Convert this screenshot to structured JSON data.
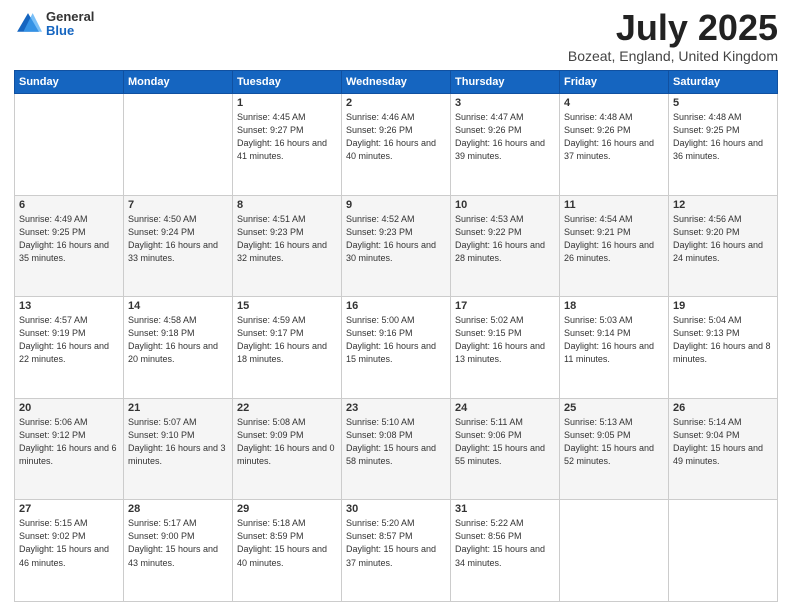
{
  "header": {
    "logo": {
      "general": "General",
      "blue": "Blue"
    },
    "title": "July 2025",
    "location": "Bozeat, England, United Kingdom"
  },
  "weekdays": [
    "Sunday",
    "Monday",
    "Tuesday",
    "Wednesday",
    "Thursday",
    "Friday",
    "Saturday"
  ],
  "weeks": [
    [
      {
        "day": null
      },
      {
        "day": null
      },
      {
        "day": "1",
        "sunrise": "Sunrise: 4:45 AM",
        "sunset": "Sunset: 9:27 PM",
        "daylight": "Daylight: 16 hours and 41 minutes."
      },
      {
        "day": "2",
        "sunrise": "Sunrise: 4:46 AM",
        "sunset": "Sunset: 9:26 PM",
        "daylight": "Daylight: 16 hours and 40 minutes."
      },
      {
        "day": "3",
        "sunrise": "Sunrise: 4:47 AM",
        "sunset": "Sunset: 9:26 PM",
        "daylight": "Daylight: 16 hours and 39 minutes."
      },
      {
        "day": "4",
        "sunrise": "Sunrise: 4:48 AM",
        "sunset": "Sunset: 9:26 PM",
        "daylight": "Daylight: 16 hours and 37 minutes."
      },
      {
        "day": "5",
        "sunrise": "Sunrise: 4:48 AM",
        "sunset": "Sunset: 9:25 PM",
        "daylight": "Daylight: 16 hours and 36 minutes."
      }
    ],
    [
      {
        "day": "6",
        "sunrise": "Sunrise: 4:49 AM",
        "sunset": "Sunset: 9:25 PM",
        "daylight": "Daylight: 16 hours and 35 minutes."
      },
      {
        "day": "7",
        "sunrise": "Sunrise: 4:50 AM",
        "sunset": "Sunset: 9:24 PM",
        "daylight": "Daylight: 16 hours and 33 minutes."
      },
      {
        "day": "8",
        "sunrise": "Sunrise: 4:51 AM",
        "sunset": "Sunset: 9:23 PM",
        "daylight": "Daylight: 16 hours and 32 minutes."
      },
      {
        "day": "9",
        "sunrise": "Sunrise: 4:52 AM",
        "sunset": "Sunset: 9:23 PM",
        "daylight": "Daylight: 16 hours and 30 minutes."
      },
      {
        "day": "10",
        "sunrise": "Sunrise: 4:53 AM",
        "sunset": "Sunset: 9:22 PM",
        "daylight": "Daylight: 16 hours and 28 minutes."
      },
      {
        "day": "11",
        "sunrise": "Sunrise: 4:54 AM",
        "sunset": "Sunset: 9:21 PM",
        "daylight": "Daylight: 16 hours and 26 minutes."
      },
      {
        "day": "12",
        "sunrise": "Sunrise: 4:56 AM",
        "sunset": "Sunset: 9:20 PM",
        "daylight": "Daylight: 16 hours and 24 minutes."
      }
    ],
    [
      {
        "day": "13",
        "sunrise": "Sunrise: 4:57 AM",
        "sunset": "Sunset: 9:19 PM",
        "daylight": "Daylight: 16 hours and 22 minutes."
      },
      {
        "day": "14",
        "sunrise": "Sunrise: 4:58 AM",
        "sunset": "Sunset: 9:18 PM",
        "daylight": "Daylight: 16 hours and 20 minutes."
      },
      {
        "day": "15",
        "sunrise": "Sunrise: 4:59 AM",
        "sunset": "Sunset: 9:17 PM",
        "daylight": "Daylight: 16 hours and 18 minutes."
      },
      {
        "day": "16",
        "sunrise": "Sunrise: 5:00 AM",
        "sunset": "Sunset: 9:16 PM",
        "daylight": "Daylight: 16 hours and 15 minutes."
      },
      {
        "day": "17",
        "sunrise": "Sunrise: 5:02 AM",
        "sunset": "Sunset: 9:15 PM",
        "daylight": "Daylight: 16 hours and 13 minutes."
      },
      {
        "day": "18",
        "sunrise": "Sunrise: 5:03 AM",
        "sunset": "Sunset: 9:14 PM",
        "daylight": "Daylight: 16 hours and 11 minutes."
      },
      {
        "day": "19",
        "sunrise": "Sunrise: 5:04 AM",
        "sunset": "Sunset: 9:13 PM",
        "daylight": "Daylight: 16 hours and 8 minutes."
      }
    ],
    [
      {
        "day": "20",
        "sunrise": "Sunrise: 5:06 AM",
        "sunset": "Sunset: 9:12 PM",
        "daylight": "Daylight: 16 hours and 6 minutes."
      },
      {
        "day": "21",
        "sunrise": "Sunrise: 5:07 AM",
        "sunset": "Sunset: 9:10 PM",
        "daylight": "Daylight: 16 hours and 3 minutes."
      },
      {
        "day": "22",
        "sunrise": "Sunrise: 5:08 AM",
        "sunset": "Sunset: 9:09 PM",
        "daylight": "Daylight: 16 hours and 0 minutes."
      },
      {
        "day": "23",
        "sunrise": "Sunrise: 5:10 AM",
        "sunset": "Sunset: 9:08 PM",
        "daylight": "Daylight: 15 hours and 58 minutes."
      },
      {
        "day": "24",
        "sunrise": "Sunrise: 5:11 AM",
        "sunset": "Sunset: 9:06 PM",
        "daylight": "Daylight: 15 hours and 55 minutes."
      },
      {
        "day": "25",
        "sunrise": "Sunrise: 5:13 AM",
        "sunset": "Sunset: 9:05 PM",
        "daylight": "Daylight: 15 hours and 52 minutes."
      },
      {
        "day": "26",
        "sunrise": "Sunrise: 5:14 AM",
        "sunset": "Sunset: 9:04 PM",
        "daylight": "Daylight: 15 hours and 49 minutes."
      }
    ],
    [
      {
        "day": "27",
        "sunrise": "Sunrise: 5:15 AM",
        "sunset": "Sunset: 9:02 PM",
        "daylight": "Daylight: 15 hours and 46 minutes."
      },
      {
        "day": "28",
        "sunrise": "Sunrise: 5:17 AM",
        "sunset": "Sunset: 9:00 PM",
        "daylight": "Daylight: 15 hours and 43 minutes."
      },
      {
        "day": "29",
        "sunrise": "Sunrise: 5:18 AM",
        "sunset": "Sunset: 8:59 PM",
        "daylight": "Daylight: 15 hours and 40 minutes."
      },
      {
        "day": "30",
        "sunrise": "Sunrise: 5:20 AM",
        "sunset": "Sunset: 8:57 PM",
        "daylight": "Daylight: 15 hours and 37 minutes."
      },
      {
        "day": "31",
        "sunrise": "Sunrise: 5:22 AM",
        "sunset": "Sunset: 8:56 PM",
        "daylight": "Daylight: 15 hours and 34 minutes."
      },
      {
        "day": null
      },
      {
        "day": null
      }
    ]
  ]
}
